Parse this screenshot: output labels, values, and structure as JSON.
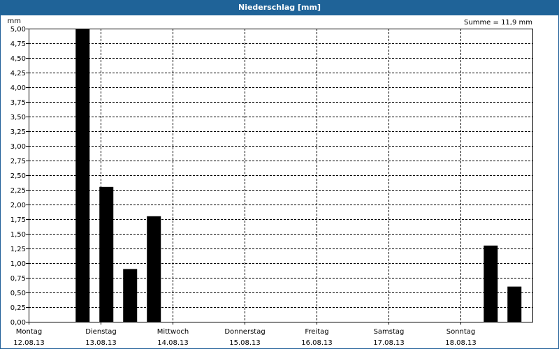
{
  "header": {
    "title": "Niederschlag [mm]"
  },
  "summary": {
    "text": "Summe = 11,9 mm"
  },
  "chart_data": {
    "type": "bar",
    "title": "Niederschlag [mm]",
    "ylabel": "mm",
    "ylim": [
      0,
      5
    ],
    "y_ticks": [
      "0,00",
      "0,25",
      "0,50",
      "0,75",
      "1,00",
      "1,25",
      "1,50",
      "1,75",
      "2,00",
      "2,25",
      "2,50",
      "2,75",
      "3,00",
      "3,25",
      "3,50",
      "3,75",
      "4,00",
      "4,25",
      "4,50",
      "4,75",
      "5,00"
    ],
    "grid": true,
    "x_days": [
      {
        "day": "Montag",
        "date": "12.08.13"
      },
      {
        "day": "Dienstag",
        "date": "13.08.13"
      },
      {
        "day": "Mittwoch",
        "date": "14.08.13"
      },
      {
        "day": "Donnerstag",
        "date": "15.08.13"
      },
      {
        "day": "Freitag",
        "date": "16.08.13"
      },
      {
        "day": "Samstag",
        "date": "17.08.13"
      },
      {
        "day": "Sonntag",
        "date": "18.08.13"
      }
    ],
    "bars": [
      {
        "day_offset": 0.75,
        "value": 5.0
      },
      {
        "day_offset": 1.08,
        "value": 2.3
      },
      {
        "day_offset": 1.41,
        "value": 0.9
      },
      {
        "day_offset": 1.74,
        "value": 1.8
      },
      {
        "day_offset": 6.42,
        "value": 1.3
      },
      {
        "day_offset": 6.75,
        "value": 0.6
      }
    ],
    "colors": {
      "bar": "#000000",
      "title_bar": "#1f6398"
    }
  }
}
